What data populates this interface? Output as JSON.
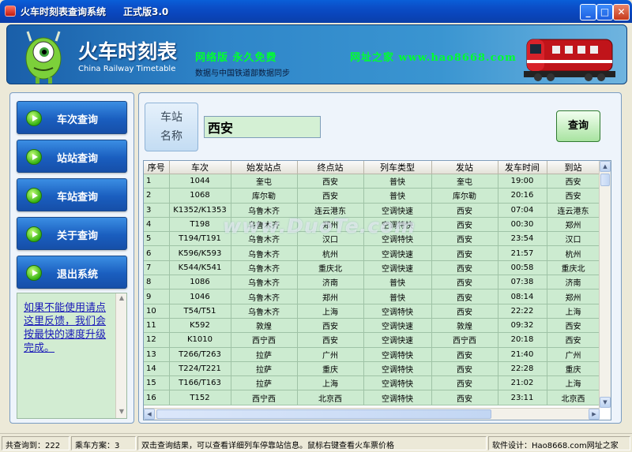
{
  "window": {
    "title": "火车时刻表查询系统",
    "version": "正式版3.0",
    "min_icon": "minimize-icon",
    "max_icon": "maximize-icon",
    "close_icon": "close-icon"
  },
  "banner": {
    "title": "火车时刻表",
    "subtitle": "China Railway Timetable",
    "slogan": "网络版 永久免费",
    "site": "网址之家 www.hao8668.com",
    "sync_note": "数据与中国铁道部数据同步",
    "accent_green": "#00ff30"
  },
  "nav": [
    {
      "label": "车次查询",
      "icon": "play-icon"
    },
    {
      "label": "站站查询",
      "icon": "play-icon"
    },
    {
      "label": "车站查询",
      "icon": "play-icon"
    },
    {
      "label": "关于查询",
      "icon": "play-icon"
    },
    {
      "label": "退出系统",
      "icon": "play-icon"
    }
  ],
  "feedback": "如果不能使用请点这里反馈，我们会按最快的速度升级完成。",
  "search": {
    "label_line1": "车站",
    "label_line2": "名称",
    "value": "西安",
    "query_button": "查询"
  },
  "table": {
    "columns": [
      "序号",
      "车次",
      "始发站点",
      "终点站",
      "列车类型",
      "发站",
      "发车时间",
      "到站"
    ],
    "rows": [
      [
        "1",
        "1044",
        "奎屯",
        "西安",
        "普快",
        "奎屯",
        "19:00",
        "西安"
      ],
      [
        "2",
        "1068",
        "库尔勒",
        "西安",
        "普快",
        "库尔勒",
        "20:16",
        "西安"
      ],
      [
        "3",
        "K1352/K1353",
        "乌鲁木齐",
        "连云港东",
        "空调快速",
        "西安",
        "07:04",
        "连云港东"
      ],
      [
        "4",
        "T198",
        "乌鲁木齐",
        "郑州",
        "空调特快",
        "西安",
        "00:30",
        "郑州"
      ],
      [
        "5",
        "T194/T191",
        "乌鲁木齐",
        "汉口",
        "空调特快",
        "西安",
        "23:54",
        "汉口"
      ],
      [
        "6",
        "K596/K593",
        "乌鲁木齐",
        "杭州",
        "空调快速",
        "西安",
        "21:57",
        "杭州"
      ],
      [
        "7",
        "K544/K541",
        "乌鲁木齐",
        "重庆北",
        "空调快速",
        "西安",
        "00:58",
        "重庆北"
      ],
      [
        "8",
        "1086",
        "乌鲁木齐",
        "济南",
        "普快",
        "西安",
        "07:38",
        "济南"
      ],
      [
        "9",
        "1046",
        "乌鲁木齐",
        "郑州",
        "普快",
        "西安",
        "08:14",
        "郑州"
      ],
      [
        "10",
        "T54/T51",
        "乌鲁木齐",
        "上海",
        "空调特快",
        "西安",
        "22:22",
        "上海"
      ],
      [
        "11",
        "K592",
        "敦煌",
        "西安",
        "空调快速",
        "敦煌",
        "09:32",
        "西安"
      ],
      [
        "12",
        "K1010",
        "西宁西",
        "西安",
        "空调快速",
        "西宁西",
        "20:18",
        "西安"
      ],
      [
        "13",
        "T266/T263",
        "拉萨",
        "广州",
        "空调特快",
        "西安",
        "21:40",
        "广州"
      ],
      [
        "14",
        "T224/T221",
        "拉萨",
        "重庆",
        "空调特快",
        "西安",
        "22:28",
        "重庆"
      ],
      [
        "15",
        "T166/T163",
        "拉萨",
        "上海",
        "空调特快",
        "西安",
        "21:02",
        "上海"
      ],
      [
        "16",
        "T152",
        "西宁西",
        "北京西",
        "空调特快",
        "西安",
        "23:11",
        "北京西"
      ]
    ]
  },
  "watermark": "www.DuoTe.com",
  "status": {
    "count": "共查询到：222",
    "plan": "乘车方案：3",
    "hint": "双击查询结果，可以查看详细列车停靠站信息。鼠标右键查看火车票价格",
    "credit": "软件设计：Hao8668.com网址之家"
  }
}
